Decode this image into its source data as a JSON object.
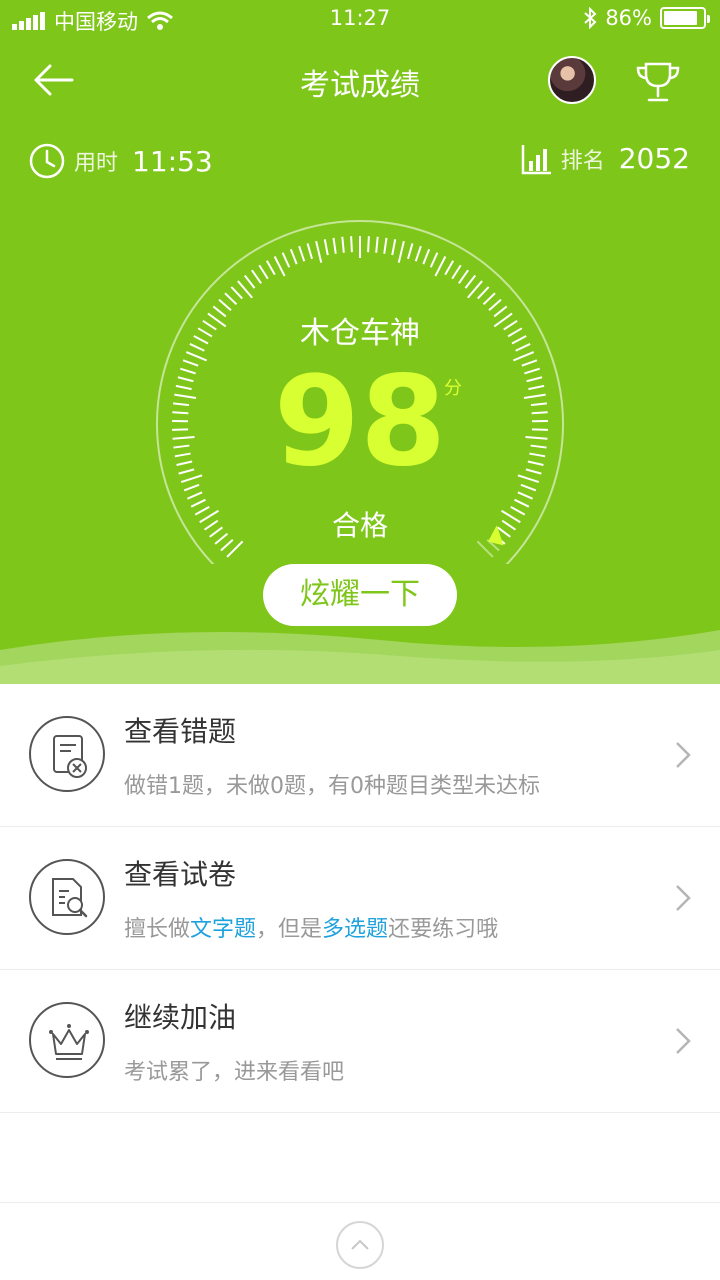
{
  "status_bar": {
    "carrier": "中国移动",
    "time": "11:27",
    "battery": "86%",
    "battery_level": 0.86
  },
  "nav": {
    "title": "考试成绩",
    "back_icon": "back-arrow-icon",
    "trophy_icon": "trophy-icon"
  },
  "stats": {
    "time_label": "用时",
    "time_value": "11:53",
    "rank_label": "排名",
    "rank_value": "2052"
  },
  "result": {
    "user_name": "木仓车神",
    "score": "98",
    "score_unit": "分",
    "status": "合格",
    "share_button": "炫耀一下",
    "score_fraction": 0.98
  },
  "menu": [
    {
      "title": "查看错题",
      "subtitle": "做错1题，未做0题，有0种题目类型未达标",
      "icon": "wrong-answers-icon"
    },
    {
      "title": "查看试卷",
      "subtitle_parts": [
        "擅长做",
        "文字题",
        "，但是",
        "多选题",
        "还要练习哦"
      ],
      "icon": "paper-search-icon"
    },
    {
      "title": "继续加油",
      "subtitle": "考试累了，进来看看吧",
      "icon": "crown-icon"
    }
  ],
  "colors": {
    "brand_green": "#7fc61a",
    "score_yellow": "#d8ff32",
    "link_blue": "#1fa1de"
  }
}
